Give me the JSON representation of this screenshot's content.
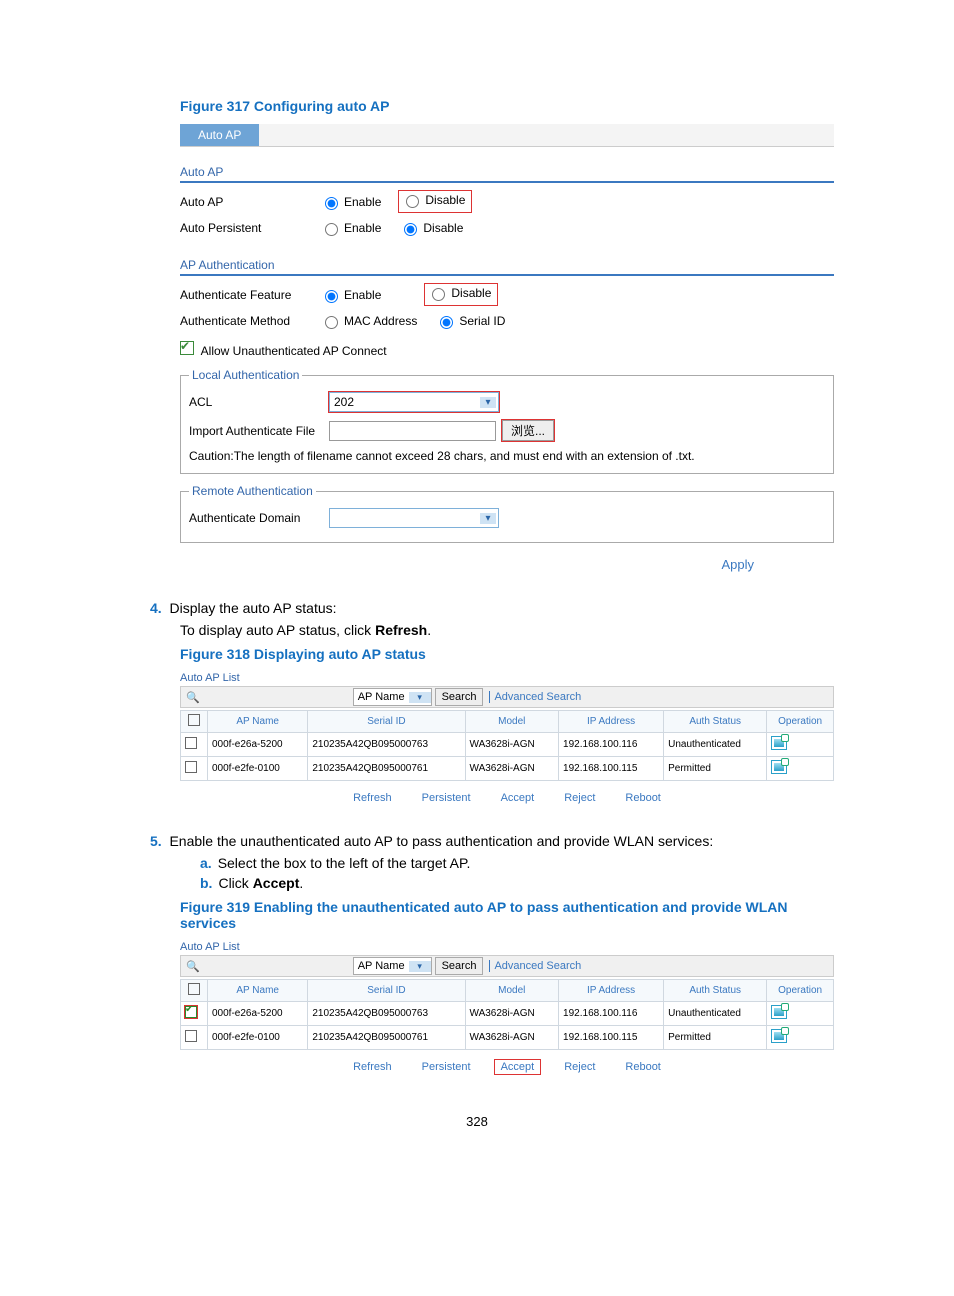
{
  "fig317": {
    "caption": "Figure 317 Configuring auto AP",
    "tab": "Auto AP",
    "section_autoap": "Auto AP",
    "row_autoap": "Auto AP",
    "row_autopersistent": "Auto Persistent",
    "enable": "Enable",
    "disable": "Disable",
    "section_apauth": "AP Authentication",
    "row_authfeature": "Authenticate Feature",
    "row_authmethod": "Authenticate Method",
    "mac_address": "MAC Address",
    "serial_id": "Serial ID",
    "allow_unauth": "Allow Unauthenticated AP Connect",
    "legend_local": "Local Authentication",
    "acl_label": "ACL",
    "acl_value": "202",
    "import_label": "Import Authenticate File",
    "browse_label": "浏览...",
    "caution": "Caution:The length of filename cannot exceed 28 chars, and must end with an extension of .txt.",
    "legend_remote": "Remote Authentication",
    "auth_domain": "Authenticate Domain",
    "apply": "Apply"
  },
  "step4": {
    "num": "4.",
    "title": "Display the auto AP status:",
    "line": "To display auto AP status, click ",
    "bold": "Refresh",
    "caption": "Figure 318 Displaying auto AP status"
  },
  "aplist": {
    "title": "Auto AP List",
    "search_field": "AP Name",
    "search_btn": "Search",
    "adv": "Advanced Search",
    "headers": [
      "",
      "AP Name",
      "Serial ID",
      "Model",
      "IP Address",
      "Auth Status",
      "Operation"
    ],
    "buttons": [
      "Refresh",
      "Persistent",
      "Accept",
      "Reject",
      "Reboot"
    ],
    "rows318": [
      {
        "ap": "000f-e26a-5200",
        "serial": "210235A42QB095000763",
        "model": "WA3628i-AGN",
        "ip": "192.168.100.116",
        "auth": "Unauthenticated"
      },
      {
        "ap": "000f-e2fe-0100",
        "serial": "210235A42QB095000761",
        "model": "WA3628i-AGN",
        "ip": "192.168.100.115",
        "auth": "Permitted"
      }
    ],
    "rows319": [
      {
        "ap": "000f-e26a-5200",
        "serial": "210235A42QB095000763",
        "model": "WA3628i-AGN",
        "ip": "192.168.100.116",
        "auth": "Unauthenticated",
        "checked": true
      },
      {
        "ap": "000f-e2fe-0100",
        "serial": "210235A42QB095000761",
        "model": "WA3628i-AGN",
        "ip": "192.168.100.115",
        "auth": "Permitted"
      }
    ]
  },
  "step5": {
    "num": "5.",
    "title": "Enable the unauthenticated auto AP to pass authentication and provide WLAN services:",
    "a": "Select the box to the left of the target AP.",
    "b_prefix": "Click ",
    "b_bold": "Accept",
    "caption": "Figure 319 Enabling the unauthenticated auto AP to pass authentication and provide WLAN services"
  },
  "page_number": "328",
  "letters": {
    "a": "a.",
    "b": "b."
  }
}
